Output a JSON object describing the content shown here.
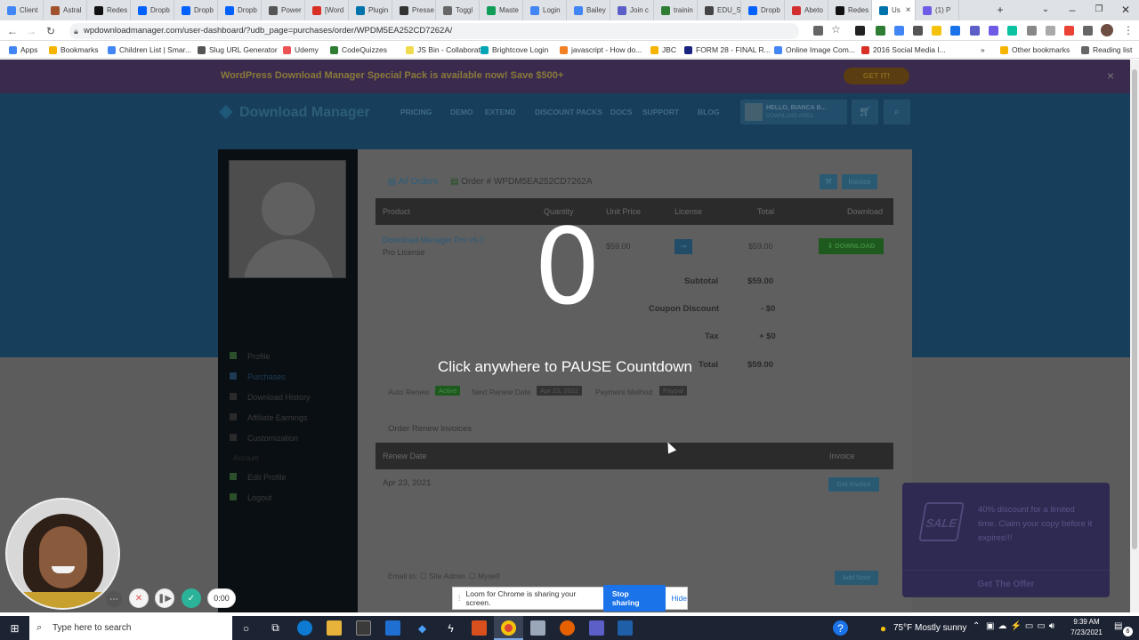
{
  "browser": {
    "tabs": [
      {
        "label": "Client",
        "color": "#4285f4"
      },
      {
        "label": "Astral",
        "color": "#a0522d"
      },
      {
        "label": "Redes",
        "color": "#111111"
      },
      {
        "label": "Dropb",
        "color": "#0061ff"
      },
      {
        "label": "Dropb",
        "color": "#0061ff"
      },
      {
        "label": "Dropb",
        "color": "#0061ff"
      },
      {
        "label": "Power",
        "color": "#555555"
      },
      {
        "label": "[Word",
        "color": "#d93025"
      },
      {
        "label": "Plugin",
        "color": "#0073aa"
      },
      {
        "label": "Presse",
        "color": "#333333"
      },
      {
        "label": "Toggl",
        "color": "#666666"
      },
      {
        "label": "Maste",
        "color": "#0f9d58"
      },
      {
        "label": "Login",
        "color": "#4285f4"
      },
      {
        "label": "Bailey",
        "color": "#4285f4"
      },
      {
        "label": "Join c",
        "color": "#5b5fc7"
      },
      {
        "label": "trainin",
        "color": "#2e7d32"
      },
      {
        "label": "EDU_S",
        "color": "#444444"
      },
      {
        "label": "Dropb",
        "color": "#0061ff"
      },
      {
        "label": "Abeto",
        "color": "#d32f2f"
      },
      {
        "label": "Redes",
        "color": "#111111"
      },
      {
        "label": "Us",
        "color": "#0073aa",
        "active": true
      },
      {
        "label": "(1) P",
        "color": "#6e5ce6"
      }
    ],
    "tab_close": "×",
    "new_tab": "+",
    "url": "wpdownloadmanager.com/user-dashboard/?udb_page=purchases/order/WPDM5EA252CD7262A/",
    "bookmarks": [
      {
        "label": "Apps",
        "color": "#4285f4"
      },
      {
        "label": "Bookmarks",
        "color": "#f4b400"
      },
      {
        "label": "Children List | Smar...",
        "color": "#4285f4"
      },
      {
        "label": "Slug URL Generator",
        "color": "#555555"
      },
      {
        "label": "Udemy",
        "color": "#ec5252"
      },
      {
        "label": "CodeQuizzes",
        "color": "#2e7d32"
      },
      {
        "label": "JS Bin - Collaborati...",
        "color": "#f0db4f"
      },
      {
        "label": "Brightcove Login",
        "color": "#00a4b4"
      },
      {
        "label": "javascript - How do...",
        "color": "#f48024"
      },
      {
        "label": "JBC",
        "color": "#f4b400"
      },
      {
        "label": "FORM 28 - FINAL R...",
        "color": "#1a237e"
      },
      {
        "label": "Online Image Com...",
        "color": "#4285f4"
      },
      {
        "label": "2016 Social Media I...",
        "color": "#d93025"
      }
    ],
    "bookmarks_more": "»",
    "other_bookmarks": "Other bookmarks",
    "reading_list": "Reading list"
  },
  "site": {
    "promo_text": "WordPress Download Manager Special Pack is available now! Save $500+",
    "promo_button": "GET IT!",
    "promo_close": "×",
    "logo": "Download Manager",
    "nav": [
      "PRICING",
      "DEMO",
      "EXTEND",
      "DISCOUNT PACKS",
      "DOCS",
      "SUPPORT",
      "BLOG"
    ],
    "user_greeting": "HELLO, BIANCA B...",
    "user_sub": "DOWNLOAD AREA",
    "sidebar": [
      "Profile",
      "Purchases",
      "Download History",
      "Affiliate Earnings",
      "Customization"
    ],
    "sidebar_section": "Account",
    "sidebar_account": [
      "Edit Profile",
      "Logout"
    ],
    "breadcrumb_all": "All Orders",
    "order_id": "Order # WPDM5EA252CD7262A",
    "invoice_btn": "Invoice",
    "table_headers": [
      "Product",
      "Quantity",
      "Unit Price",
      "License",
      "Total",
      "Download"
    ],
    "product_name": "Download Manager Pro v6.0",
    "product_license": "Pro License",
    "unit_price": "$59.00",
    "line_total": "$59.00",
    "download_btn": "DOWNLOAD",
    "subtotal_label": "Subtotal",
    "subtotal": "$59.00",
    "coupon_label": "Coupon Discount",
    "coupon": "- $0",
    "tax_label": "Tax",
    "tax": "+ $0",
    "total_label": "Total",
    "total": "$59.00",
    "auto_renew_label": "Auto Renew",
    "auto_renew_value": "Active",
    "next_renew_label": "Next Renew Date",
    "next_renew_value": "Apr 23, 2022",
    "payment_label": "Payment Method",
    "payment_value": "Paypal",
    "renew_invoices_title": "Order Renew Invoices",
    "renew_headers": [
      "Renew Date",
      "Invoice"
    ],
    "renew_date": "Apr 23, 2021",
    "get_invoice_btn": "Get Invoice",
    "email_to": "Email to:",
    "site_admin": "Site Admin",
    "myself": "Myself",
    "add_note_btn": "Add Note",
    "offer_text": "40% discount for a limited time. Claim your copy before it expires!!!",
    "offer_button": "Get The Offer",
    "offer_badge": "SALE"
  },
  "overlay": {
    "countdown": "0",
    "message": "Click anywhere to PAUSE Countdown"
  },
  "loom": {
    "timer": "0:00",
    "share_text": "Loom for Chrome is sharing your screen.",
    "stop_sharing": "Stop sharing",
    "hide": "Hide"
  },
  "taskbar": {
    "search_placeholder": "Type here to search",
    "weather": "75°F  Mostly sunny",
    "time": "9:39 AM",
    "date": "7/23/2021",
    "notifications": "6"
  }
}
